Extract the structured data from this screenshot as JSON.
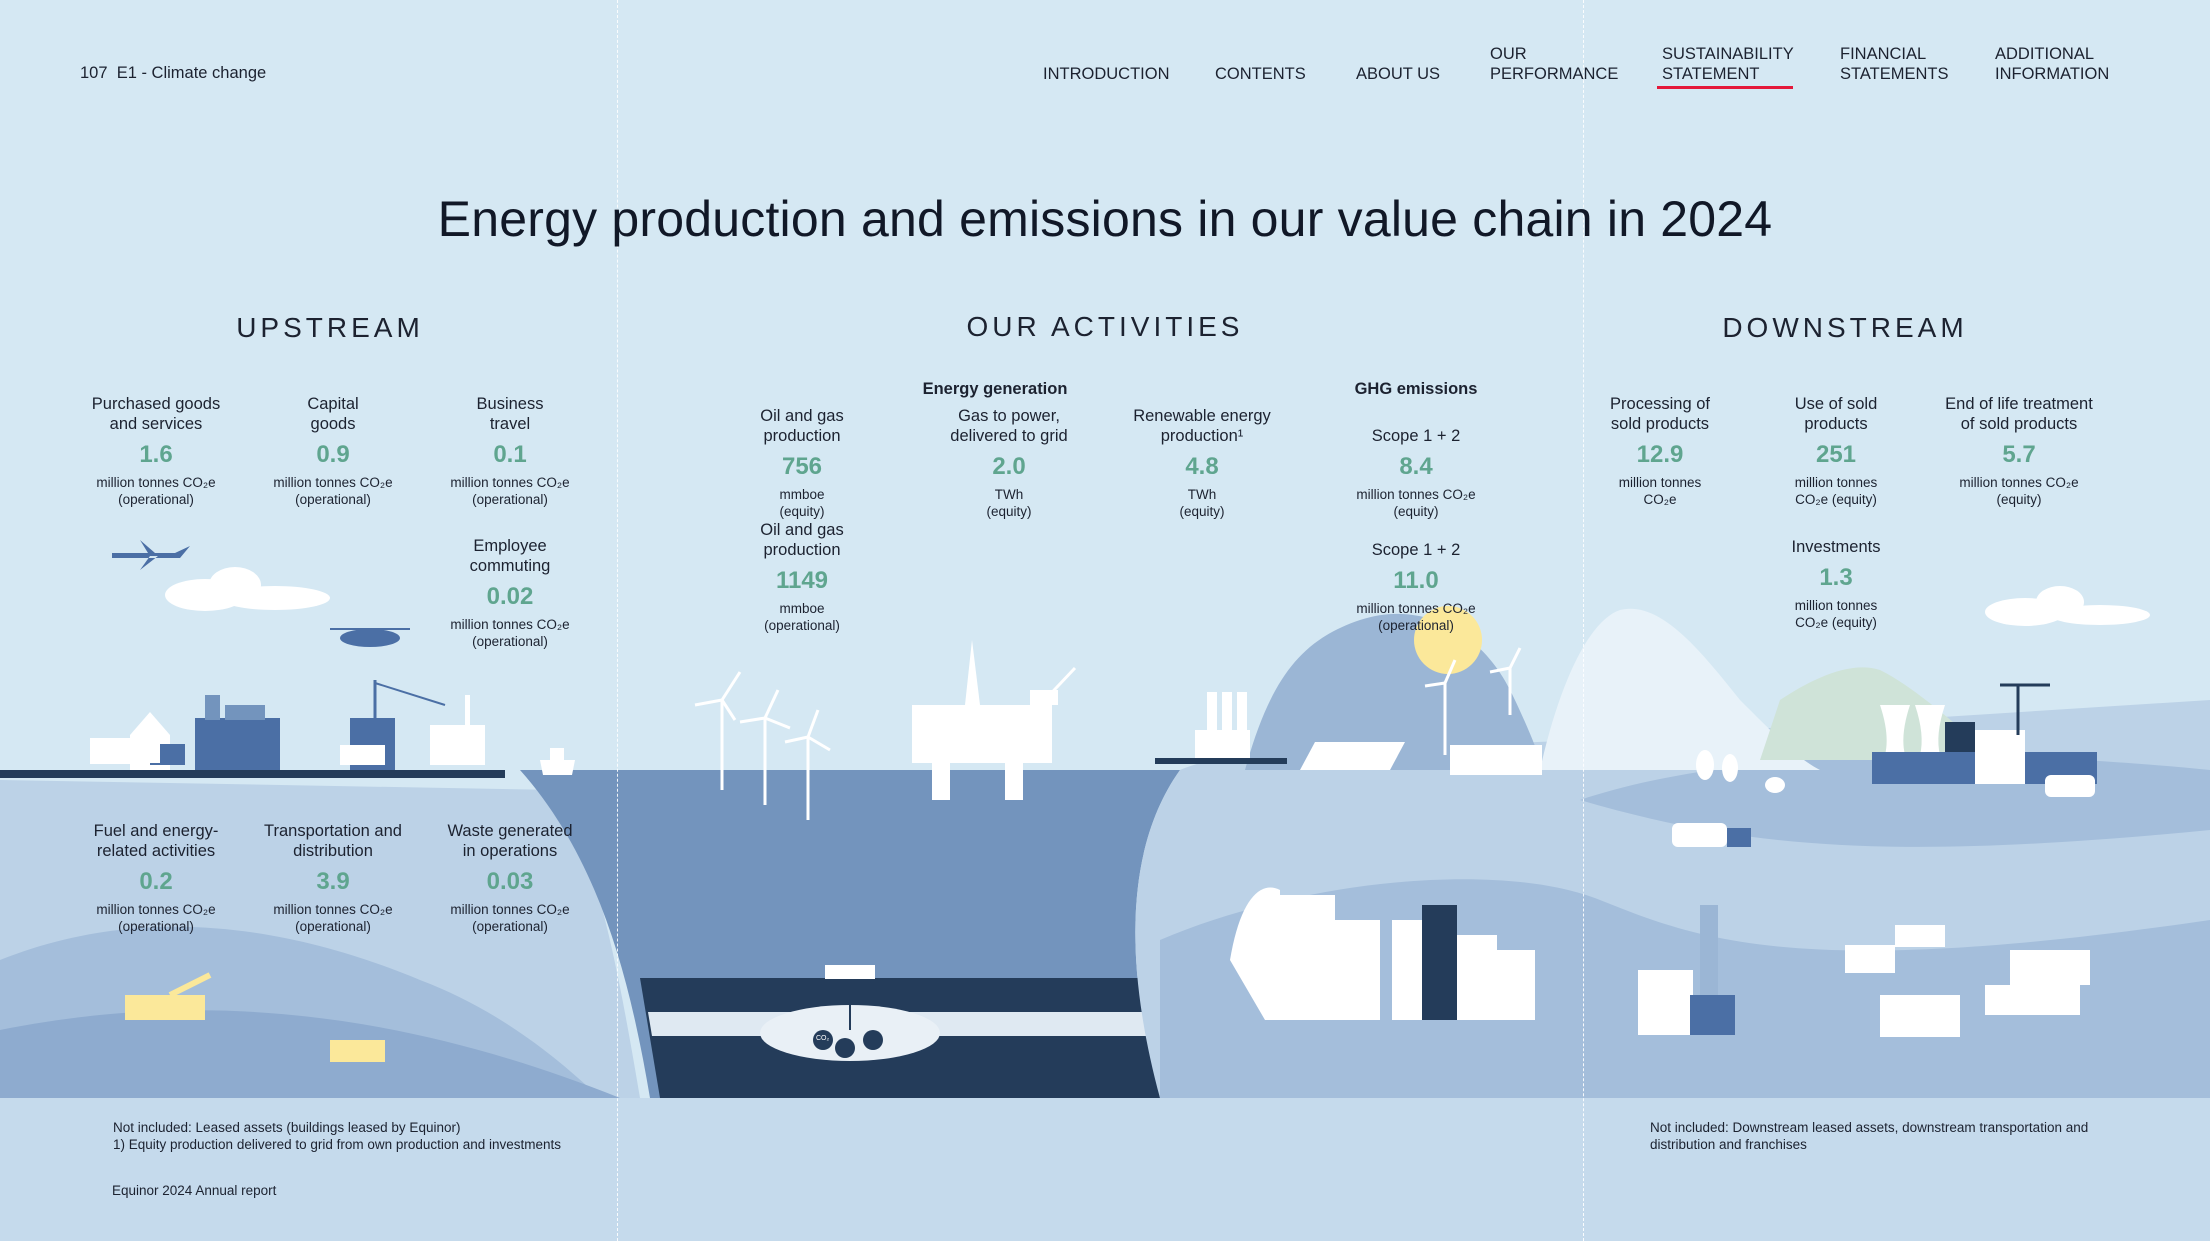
{
  "header": {
    "page_number": "107",
    "section": "E1 - Climate change",
    "nav": [
      {
        "label": "INTRODUCTION"
      },
      {
        "label": "CONTENTS"
      },
      {
        "label": "ABOUT US"
      },
      {
        "label": "OUR\nPERFORMANCE"
      },
      {
        "label": "SUSTAINABILITY\nSTATEMENT",
        "active": true
      },
      {
        "label": "FINANCIAL\nSTATEMENTS"
      },
      {
        "label": "ADDITIONAL\nINFORMATION"
      }
    ],
    "active_color": "#e4183a"
  },
  "title": "Energy production and emissions in our value chain in 2024",
  "sections": {
    "upstream": "UPSTREAM",
    "activities": "OUR ACTIVITIES",
    "downstream": "DOWNSTREAM"
  },
  "upstream": [
    {
      "label": "Purchased goods\nand services",
      "value": "1.6",
      "unit": "million tonnes CO₂e\n(operational)"
    },
    {
      "label": "Capital\ngoods",
      "value": "0.9",
      "unit": "million tonnes CO₂e\n(operational)"
    },
    {
      "label": "Business\ntravel",
      "value": "0.1",
      "unit": "million tonnes CO₂e\n(operational)"
    },
    {
      "label": "Employee\ncommuting",
      "value": "0.02",
      "unit": "million tonnes CO₂e\n(operational)"
    },
    {
      "label": "Fuel and energy-\nrelated activities",
      "value": "0.2",
      "unit": "million tonnes CO₂e\n(operational)"
    },
    {
      "label": "Transportation and\ndistribution",
      "value": "3.9",
      "unit": "million tonnes CO₂e\n(operational)"
    },
    {
      "label": "Waste generated\nin operations",
      "value": "0.03",
      "unit": "million tonnes CO₂e\n(operational)"
    }
  ],
  "activities": {
    "energy_generation_title": "Energy generation",
    "ghg_title": "GHG emissions",
    "items": [
      {
        "label": "Oil and gas\nproduction",
        "value": "756",
        "unit": "mmboe\n(equity)"
      },
      {
        "label": "Oil and gas\nproduction",
        "value": "1149",
        "unit": "mmboe\n(operational)"
      },
      {
        "label": "Gas to power,\ndelivered to grid",
        "value": "2.0",
        "unit": "TWh\n(equity)"
      },
      {
        "label": "Renewable energy\nproduction¹",
        "value": "4.8",
        "unit": "TWh\n(equity)"
      },
      {
        "label": "Scope 1 + 2",
        "value": "8.4",
        "unit": "million tonnes CO₂e\n(equity)"
      },
      {
        "label": "Scope 1 + 2",
        "value": "11.0",
        "unit": "million tonnes CO₂e\n(operational)"
      }
    ]
  },
  "downstream": [
    {
      "label": "Processing of\nsold products",
      "value": "12.9",
      "unit": "million tonnes\nCO₂e"
    },
    {
      "label": "Use of sold\nproducts",
      "value": "251",
      "unit": "million tonnes\nCO₂e (equity)"
    },
    {
      "label": "End of life treatment\nof sold products",
      "value": "5.7",
      "unit": "million tonnes CO₂e\n(equity)"
    },
    {
      "label": "Investments",
      "value": "1.3",
      "unit": "million tonnes\nCO₂e (equity)"
    }
  ],
  "co2_bubble": "CO₂",
  "footer": {
    "left_notes": "Not included: Leased assets (buildings leased by Equinor)\n1)  Equity production delivered to grid from own production and investments",
    "right_note": "Not included: Downstream leased assets, downstream transportation and\ndistribution and franchises",
    "report": "Equinor 2024 Annual report"
  },
  "colors": {
    "value_green": "#5fa58f",
    "sky": "#d5e8f3",
    "land": "#bfd4e8",
    "sea": "#7394bd",
    "navy": "#243c5a",
    "sun": "#fbe89a"
  }
}
